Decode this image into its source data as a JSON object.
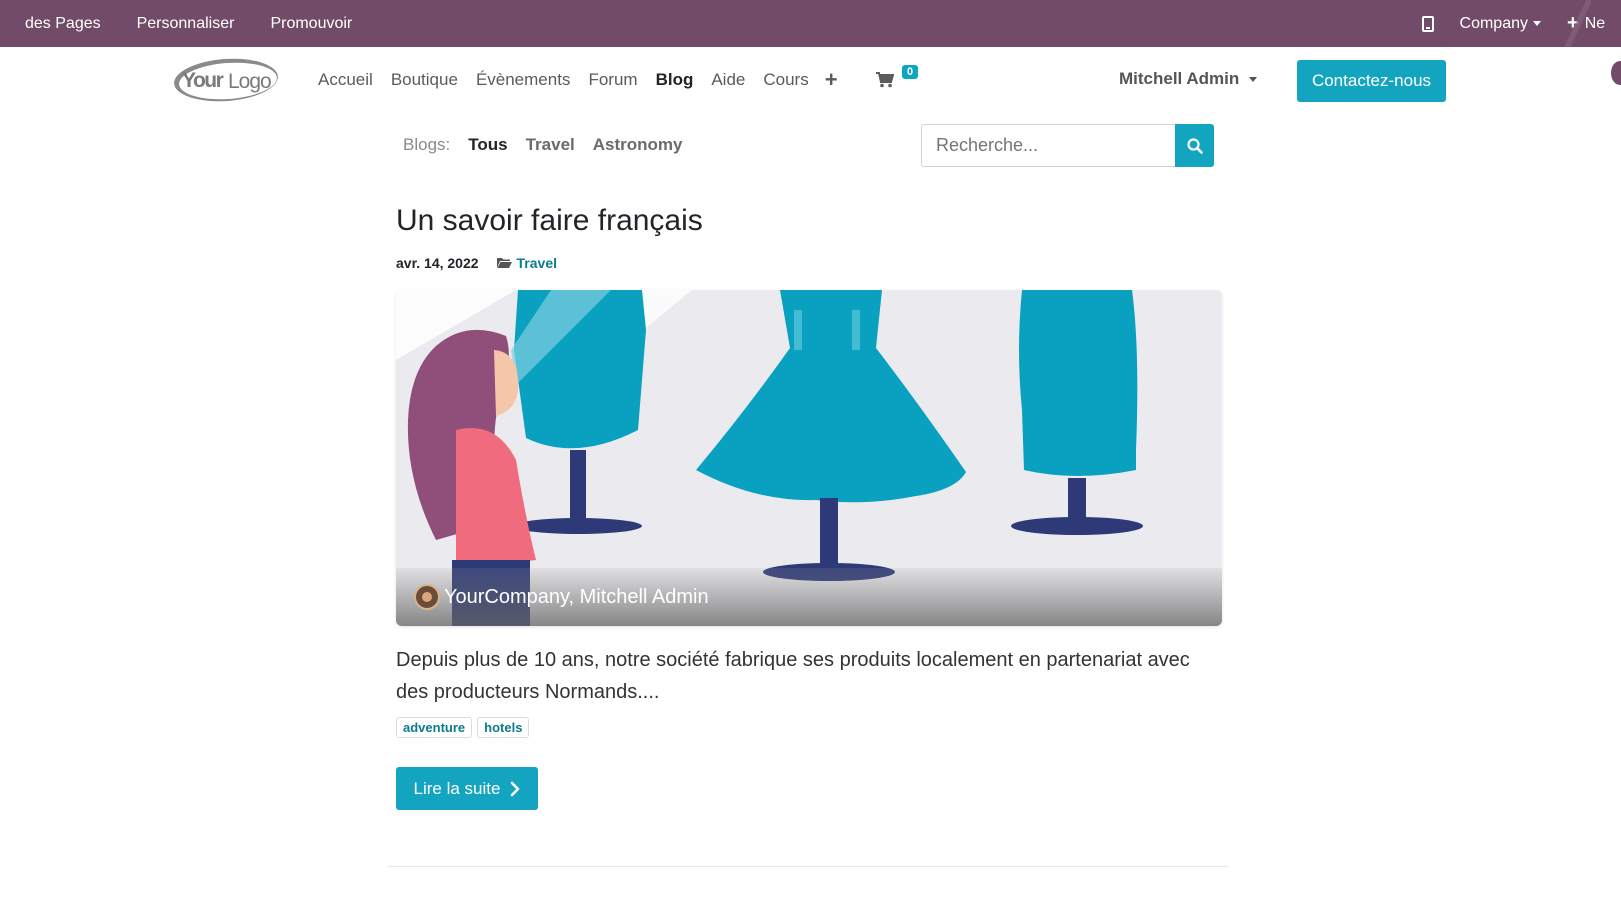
{
  "admin_bar": {
    "items": [
      "des Pages",
      "Personnaliser",
      "Promouvoir"
    ],
    "company": "Company",
    "new_label": "Ne"
  },
  "nav": {
    "logo_text": "YourLogo",
    "menu": [
      "Accueil",
      "Boutique",
      "Évènements",
      "Forum",
      "Blog",
      "Aide",
      "Cours"
    ],
    "active": "Blog",
    "cart_count": "0",
    "user": "Mitchell Admin",
    "contact": "Contactez-nous"
  },
  "blogs": {
    "label": "Blogs:",
    "items": [
      "Tous",
      "Travel",
      "Astronomy"
    ],
    "active": "Tous"
  },
  "search": {
    "placeholder": "Recherche..."
  },
  "post": {
    "title": "Un savoir faire français",
    "date": "avr. 14, 2022",
    "category": "Travel",
    "author": "YourCompany, Mitchell Admin",
    "teaser": "Depuis plus de 10 ans, notre société fabrique ses produits localement en partenariat avec des producteurs Normands....",
    "tags": [
      "adventure",
      "hotels"
    ],
    "read_more": "Lire la suite"
  },
  "colors": {
    "admin_bar": "#714b67",
    "primary": "#13a5bf",
    "link": "#0c7a8f"
  }
}
